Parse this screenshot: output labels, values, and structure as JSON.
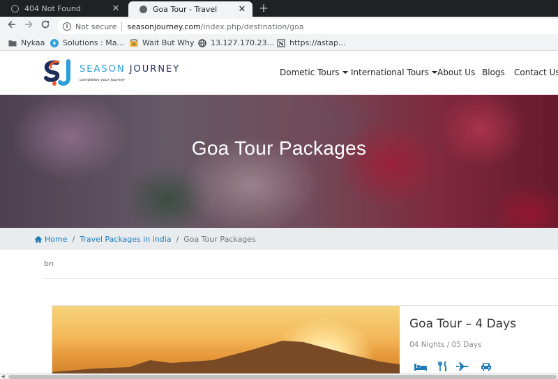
{
  "browser": {
    "tabs": [
      {
        "title": "404 Not Found",
        "active": false
      },
      {
        "title": "Goa Tour - Travel",
        "active": true
      }
    ],
    "new_tab": "+",
    "close_glyph": "✕",
    "security_label": "Not secure",
    "url_host": "seasonjourney.com",
    "url_path": "/index.php/destination/goa",
    "bookmarks": [
      {
        "label": "Nykaa",
        "icon": "folder-icon"
      },
      {
        "label": "Solutions : Ma...",
        "icon": "bolt-icon"
      },
      {
        "label": "Wait But Why",
        "icon": "wbw-icon"
      },
      {
        "label": "13.127.170.23...",
        "icon": "globe-icon"
      },
      {
        "label": "https://astap...",
        "icon": "notion-icon"
      }
    ]
  },
  "site": {
    "logo": {
      "word_a": "SEASON",
      "word_b": " JOURNEY",
      "tagline": "completes your journey"
    },
    "nav": [
      {
        "label": "Dometic Tours",
        "dropdown": true
      },
      {
        "label": "International Tours",
        "dropdown": true
      },
      {
        "label": "About Us",
        "dropdown": false
      },
      {
        "label": "Blogs",
        "dropdown": false
      },
      {
        "label": "Contact Us",
        "dropdown": false
      }
    ],
    "hero_title": "Goa Tour Packages",
    "breadcrumb": {
      "home": "Home",
      "link": "Travel Packages in india",
      "current": "Goa Tour Packages",
      "sep": "/"
    },
    "note": "bn",
    "card": {
      "title": "Goa Tour – 4 Days",
      "subtitle": "04 Nights / 05 Days",
      "amenities": [
        "hotel-icon",
        "meal-icon",
        "flight-icon",
        "car-icon"
      ]
    }
  },
  "colors": {
    "link": "#1e7bb8",
    "amenity": "#1e7bb8",
    "logo_blue": "#2a9fd8",
    "logo_navy": "#1f2d5a"
  }
}
